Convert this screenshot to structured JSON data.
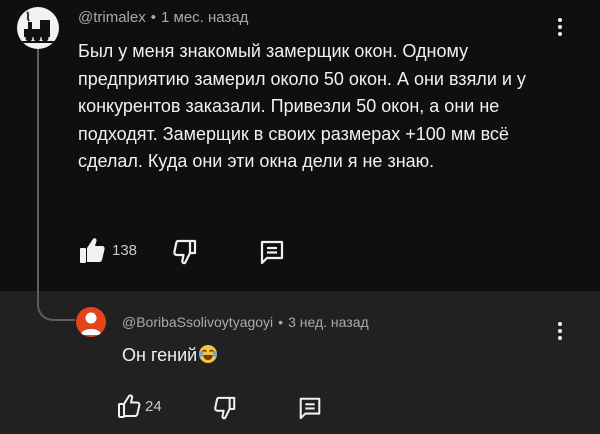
{
  "main_comment": {
    "author": "@trimalex",
    "separator": "•",
    "time": "1 мес. назад",
    "text": "Был у меня знакомый замерщик окон. Одному предприятию замерил около 50 окон. А они взяли и у конкурентов заказали. Привезли 50 окон, а они не подходят. Замерщик в своих размерах +100 мм всё сделал. Куда они эти окна дели я не знаю.",
    "like_count": "138",
    "avatar_icon": "steam-locomotive-icon"
  },
  "reply": {
    "author": "@BoribaSsolivoytyagoyi",
    "separator": "•",
    "time": "3 нед. назад",
    "text": "Он гений",
    "emoji_icon": "face-with-tears-of-joy-icon",
    "like_count": "24"
  },
  "colors": {
    "background": "#0f0f0f",
    "reply_background": "#212121",
    "text": "#f1f1f1",
    "meta": "#aaaaaa",
    "reply_avatar": "#e3441d"
  }
}
